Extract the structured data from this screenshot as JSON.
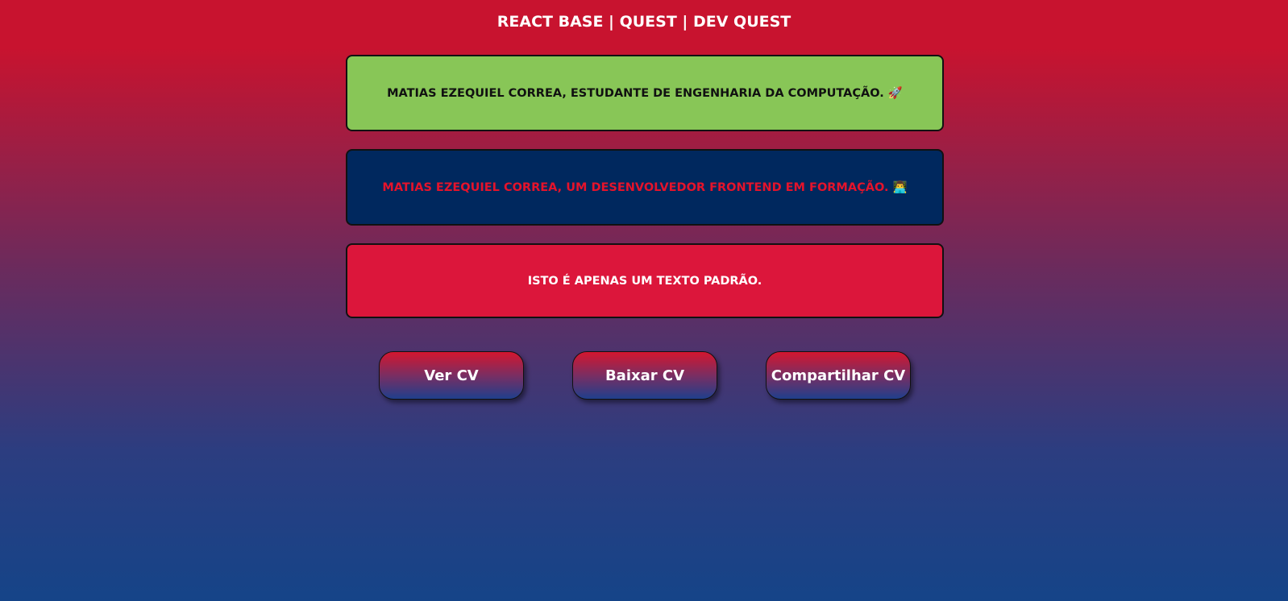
{
  "header": {
    "title": "REACT BASE | QUEST | DEV QUEST"
  },
  "cards": [
    {
      "text": "MATIAS EZEQUIEL CORREA, ESTUDANTE DE ENGENHARIA DA COMPUTAÇÃO. 🚀",
      "background": "#88c657",
      "color": "#111111"
    },
    {
      "text": "MATIAS EZEQUIEL CORREA, UM DESENVOLVEDOR FRONTEND EM FORMAÇÃO. 👨‍💻",
      "background": "#00285e",
      "color": "#e5132b"
    },
    {
      "text": "ISTO É APENAS UM TEXTO PADRÃO.",
      "background": "#dc163b",
      "color": "#ffffff"
    }
  ],
  "buttons": [
    {
      "label": "Ver CV"
    },
    {
      "label": "Baixar CV"
    },
    {
      "label": "Compartilhar CV"
    }
  ]
}
